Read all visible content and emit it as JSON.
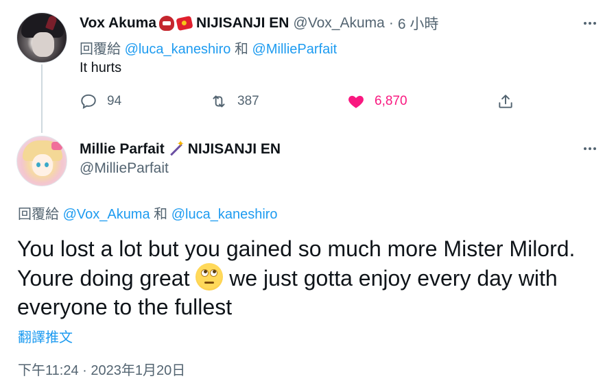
{
  "tweet1": {
    "display_name": "Vox Akuma",
    "org": "NIJISANJI EN",
    "handle": "@Vox_Akuma",
    "separator": "·",
    "time_ago": "6 小時",
    "reply_prefix": "回覆給",
    "reply_handle_1": "@luca_kaneshiro",
    "reply_and": "和",
    "reply_handle_2": "@MillieParfait",
    "text": "It hurts",
    "replies": "94",
    "retweets": "387",
    "likes": "6,870",
    "like_color": "#f91880",
    "emojis": [
      "ogre-emoji",
      "red-envelope-emoji"
    ]
  },
  "tweet2": {
    "display_name": "Millie Parfait",
    "org": "NIJISANJI EN",
    "handle": "@MillieParfait",
    "reply_prefix": "回覆給",
    "reply_handle_1": "@Vox_Akuma",
    "reply_and": "和",
    "reply_handle_2": "@luca_kaneshiro",
    "text_part1": "You lost a lot but you gained so much more Mister Milord. Youre doing great ",
    "text_part2": " we just gotta enjoy every day with everyone to the fullest",
    "translate_label": "翻譯推文",
    "timestamp": "下午11:24 · 2023年1月20日",
    "emojis": [
      "magic-wand-emoji",
      "face-with-rolling-eyes-emoji"
    ]
  },
  "colors": {
    "link": "#1d9bf0",
    "muted": "#536471",
    "text": "#0f1419"
  }
}
